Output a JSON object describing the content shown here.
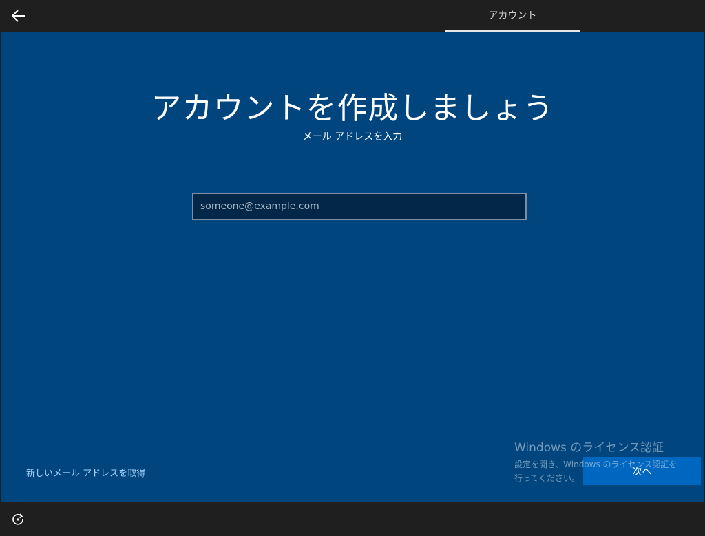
{
  "header": {
    "back_icon": "arrow-left-icon",
    "tab_label": "アカウント"
  },
  "main": {
    "title": "アカウントを作成しましょう",
    "subtitle": "メール アドレスを入力",
    "email": {
      "value": "",
      "placeholder": "someone@example.com"
    },
    "new_email_link": "新しいメール アドレスを取得",
    "next_label": "次へ"
  },
  "watermark": {
    "title": "Windows のライセンス認証",
    "body_line1": "設定を開き、Windows のライセンス認証を",
    "body_line2": "行ってください。"
  },
  "footer": {
    "accessibility_icon": "ease-of-access-icon"
  },
  "colors": {
    "panel_blue": "#00457e",
    "chrome_dark": "#1f1f1f",
    "accent_button": "#0067c0",
    "link": "#a9d3ff"
  }
}
